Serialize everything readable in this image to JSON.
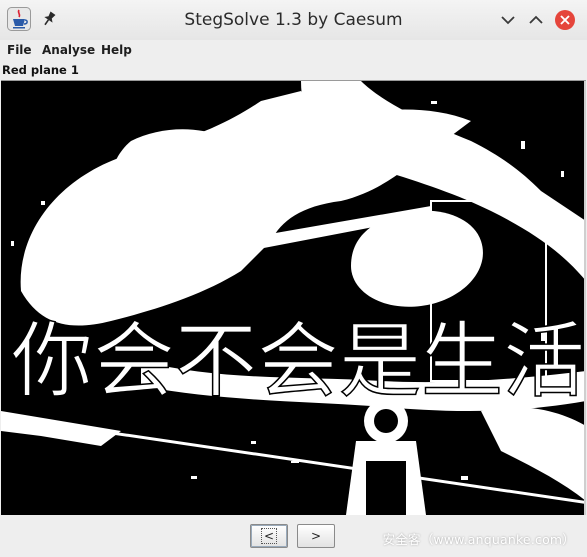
{
  "window": {
    "title": "StegSolve 1.3 by Caesum",
    "app_icon": "java-cup-icon",
    "pin_icon": "pin-icon",
    "buttons": {
      "minimize_icon": "chevron-down-icon",
      "maximize_icon": "chevron-up-icon",
      "close_icon": "close-icon",
      "close_color": "#e5453b"
    }
  },
  "menu": {
    "items": [
      {
        "label": "File"
      },
      {
        "label": "Analyse"
      },
      {
        "label": "Help"
      }
    ]
  },
  "viewer": {
    "plane_label": "Red plane 1",
    "overlay_text": "你会不会是生活",
    "background_color": "#000000",
    "foreground_color": "#ffffff"
  },
  "navigation": {
    "prev_label": "<",
    "next_label": ">"
  },
  "watermark": "安全客（www.anquanke.com）"
}
